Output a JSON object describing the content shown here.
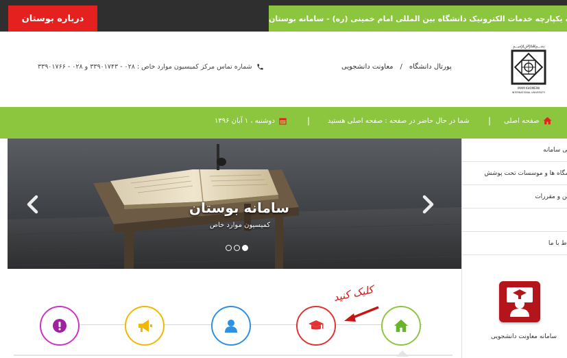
{
  "topbar": {
    "about_label": "درباره بوستان",
    "site_title": "سامانه یکپارچه خدمات الکترونیک دانشگاه بین المللی امام خمینی (ره) - سامانه بوستان"
  },
  "header": {
    "breadcrumb": [
      "پورتال دانشگاه",
      "/",
      "معاونت دانشجویی"
    ],
    "contact_text": "شماره تماس مرکز کمیسیون موارد خاص : ۰۲۸ - ۳۳۹۰۱۷۴۳ و ۰۲۸ - ۳۳۹۰۱۷۶۶",
    "logo_caption": "IMAM KHOMEINI INTERNATIONAL UNIVERSITY"
  },
  "nav": {
    "home_label": "صفحه اصلی",
    "current_page_text": "شما در حال حاضر در صفحه : صفحه اصلی هستید",
    "date_text": "دوشنبه ، ۱ آبان ۱۳۹۶"
  },
  "slider": {
    "title": "سامانه بوستان",
    "subtitle": "کمیسیون موارد خاص",
    "dots": 3,
    "active_dot": 2
  },
  "sidebar": {
    "items": [
      "قی سامانه",
      "شگاه ها و موسسات تحت پوشش",
      "نین و مقررات",
      "ر",
      "باط با ما"
    ],
    "service_label": "سامانه معاونت دانشجویی"
  },
  "annotation": {
    "click_text": "کلیک کنید"
  },
  "colors": {
    "accent_green": "#8cc63f",
    "accent_red": "#e4211f",
    "dark_bar": "#2f2f2f",
    "icon_purple": "#cc33cc",
    "icon_yellow": "#f2b705",
    "icon_blue": "#2f8fe0",
    "icon_red": "#e23232",
    "icon_green": "#6ab42d"
  },
  "bottom_icons": [
    "alert-icon",
    "megaphone-icon",
    "user-icon",
    "graduation-cap-icon",
    "home-icon"
  ]
}
